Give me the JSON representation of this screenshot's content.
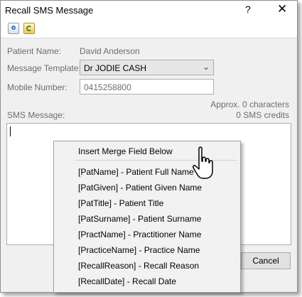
{
  "window": {
    "title": "Recall SMS Message",
    "help_label": "?",
    "close_label": "✕"
  },
  "toolbar": {
    "icons": [
      "search-report-icon",
      "refresh-icon"
    ]
  },
  "form": {
    "patient_name_label": "Patient Name:",
    "patient_name_value": "David Anderson",
    "template_label": "Message Template:",
    "template_value": "Dr JODIE CASH",
    "mobile_label": "Mobile Number:",
    "mobile_value": "0415258800",
    "approx_chars": "Approx. 0 characters",
    "sms_credits": "0 SMS credits",
    "sms_message_label": "SMS Message:"
  },
  "buttons": {
    "cancel_label": "Cancel"
  },
  "context_menu": {
    "header": "Insert Merge Field Below",
    "items": [
      "[PatName] - Patient Full Name",
      "[PatGiven] - Patient Given Name",
      "[PatTitle] - Patient Title",
      "[PatSurname] - Patient Surname",
      "[PractName] - Practitioner Name",
      "[PracticeName] - Practice Name",
      "[RecallReason] - Recall Reason",
      "[RecallDate] - Recall Date"
    ]
  },
  "colors": {
    "window_bg": "#f0f0f0",
    "label_gray": "#6d6d6d",
    "menu_bg": "#f2f2f2"
  }
}
